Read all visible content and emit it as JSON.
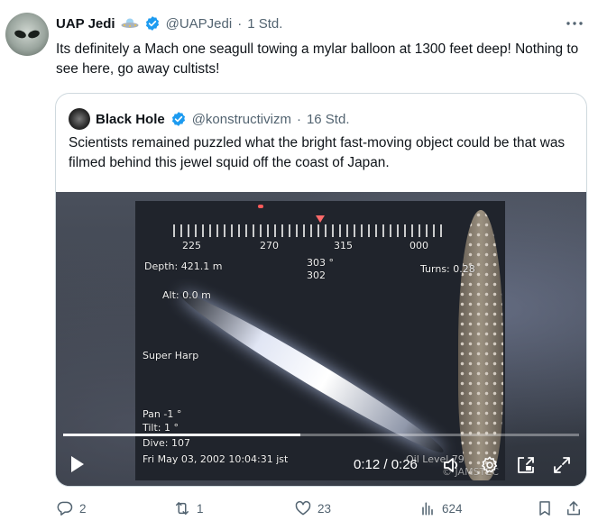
{
  "author": {
    "name": "UAP Jedi",
    "handle": "@UAPJedi",
    "separator": "·",
    "time": "1 Std.",
    "name_emoji_icon": "ufo-icon",
    "verified_icon": "verified-badge-icon"
  },
  "tweet": {
    "text": "Its definitely a Mach one seagull towing a mylar balloon at 1300 feet deep! Nothing to see here, go away cultists!"
  },
  "quoted": {
    "name": "Black Hole",
    "handle": "@konstructivizm",
    "separator": "·",
    "time": "16 Std.",
    "text": "Scientists remained puzzled what the bright fast-moving object could be that was filmed behind this jewel squid off the coast of Japan."
  },
  "video": {
    "overlay": {
      "compass_labels": [
        "225",
        "270",
        "315",
        "000"
      ],
      "depth": "Depth:  421.1 m",
      "heading_a": "303 °",
      "heading_b": "302",
      "turns": "Turns:  0.28",
      "alt": "Alt:      0.0 m",
      "camera": "Super Harp",
      "pan": "Pan      -1 °",
      "tilt": "Tilt:       1 °",
      "dive": "Dive:    107",
      "timestamp": "Fri  May 03, 2002  10:04:31  jst",
      "oil_level": "Oil Level    79",
      "watermark": "© JAMSTEC"
    },
    "timecode": "0:12 / 0:26",
    "progress": 0.46
  },
  "actions": {
    "replies": "2",
    "reposts": "1",
    "likes": "23",
    "views": "624"
  },
  "colors": {
    "text": "#0f1419",
    "secondary": "#536471",
    "verified": "#1d9bf0",
    "border": "#cfd9de"
  }
}
